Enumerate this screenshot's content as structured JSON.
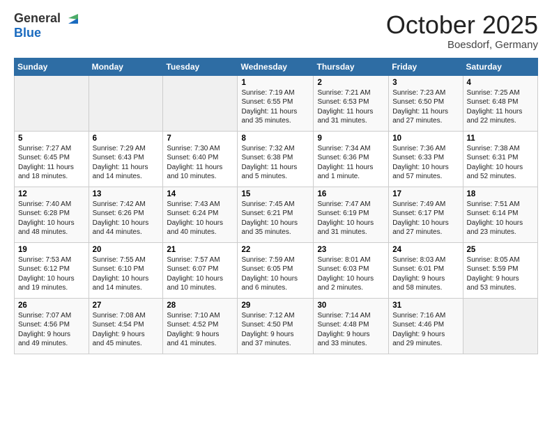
{
  "header": {
    "logo_line1": "General",
    "logo_line2": "Blue",
    "title": "October 2025",
    "location": "Boesdorf, Germany"
  },
  "days_of_week": [
    "Sunday",
    "Monday",
    "Tuesday",
    "Wednesday",
    "Thursday",
    "Friday",
    "Saturday"
  ],
  "weeks": [
    [
      {
        "day": "",
        "info": ""
      },
      {
        "day": "",
        "info": ""
      },
      {
        "day": "",
        "info": ""
      },
      {
        "day": "1",
        "info": "Sunrise: 7:19 AM\nSunset: 6:55 PM\nDaylight: 11 hours\nand 35 minutes."
      },
      {
        "day": "2",
        "info": "Sunrise: 7:21 AM\nSunset: 6:53 PM\nDaylight: 11 hours\nand 31 minutes."
      },
      {
        "day": "3",
        "info": "Sunrise: 7:23 AM\nSunset: 6:50 PM\nDaylight: 11 hours\nand 27 minutes."
      },
      {
        "day": "4",
        "info": "Sunrise: 7:25 AM\nSunset: 6:48 PM\nDaylight: 11 hours\nand 22 minutes."
      }
    ],
    [
      {
        "day": "5",
        "info": "Sunrise: 7:27 AM\nSunset: 6:45 PM\nDaylight: 11 hours\nand 18 minutes."
      },
      {
        "day": "6",
        "info": "Sunrise: 7:29 AM\nSunset: 6:43 PM\nDaylight: 11 hours\nand 14 minutes."
      },
      {
        "day": "7",
        "info": "Sunrise: 7:30 AM\nSunset: 6:40 PM\nDaylight: 11 hours\nand 10 minutes."
      },
      {
        "day": "8",
        "info": "Sunrise: 7:32 AM\nSunset: 6:38 PM\nDaylight: 11 hours\nand 5 minutes."
      },
      {
        "day": "9",
        "info": "Sunrise: 7:34 AM\nSunset: 6:36 PM\nDaylight: 11 hours\nand 1 minute."
      },
      {
        "day": "10",
        "info": "Sunrise: 7:36 AM\nSunset: 6:33 PM\nDaylight: 10 hours\nand 57 minutes."
      },
      {
        "day": "11",
        "info": "Sunrise: 7:38 AM\nSunset: 6:31 PM\nDaylight: 10 hours\nand 52 minutes."
      }
    ],
    [
      {
        "day": "12",
        "info": "Sunrise: 7:40 AM\nSunset: 6:28 PM\nDaylight: 10 hours\nand 48 minutes."
      },
      {
        "day": "13",
        "info": "Sunrise: 7:42 AM\nSunset: 6:26 PM\nDaylight: 10 hours\nand 44 minutes."
      },
      {
        "day": "14",
        "info": "Sunrise: 7:43 AM\nSunset: 6:24 PM\nDaylight: 10 hours\nand 40 minutes."
      },
      {
        "day": "15",
        "info": "Sunrise: 7:45 AM\nSunset: 6:21 PM\nDaylight: 10 hours\nand 35 minutes."
      },
      {
        "day": "16",
        "info": "Sunrise: 7:47 AM\nSunset: 6:19 PM\nDaylight: 10 hours\nand 31 minutes."
      },
      {
        "day": "17",
        "info": "Sunrise: 7:49 AM\nSunset: 6:17 PM\nDaylight: 10 hours\nand 27 minutes."
      },
      {
        "day": "18",
        "info": "Sunrise: 7:51 AM\nSunset: 6:14 PM\nDaylight: 10 hours\nand 23 minutes."
      }
    ],
    [
      {
        "day": "19",
        "info": "Sunrise: 7:53 AM\nSunset: 6:12 PM\nDaylight: 10 hours\nand 19 minutes."
      },
      {
        "day": "20",
        "info": "Sunrise: 7:55 AM\nSunset: 6:10 PM\nDaylight: 10 hours\nand 14 minutes."
      },
      {
        "day": "21",
        "info": "Sunrise: 7:57 AM\nSunset: 6:07 PM\nDaylight: 10 hours\nand 10 minutes."
      },
      {
        "day": "22",
        "info": "Sunrise: 7:59 AM\nSunset: 6:05 PM\nDaylight: 10 hours\nand 6 minutes."
      },
      {
        "day": "23",
        "info": "Sunrise: 8:01 AM\nSunset: 6:03 PM\nDaylight: 10 hours\nand 2 minutes."
      },
      {
        "day": "24",
        "info": "Sunrise: 8:03 AM\nSunset: 6:01 PM\nDaylight: 9 hours\nand 58 minutes."
      },
      {
        "day": "25",
        "info": "Sunrise: 8:05 AM\nSunset: 5:59 PM\nDaylight: 9 hours\nand 53 minutes."
      }
    ],
    [
      {
        "day": "26",
        "info": "Sunrise: 7:07 AM\nSunset: 4:56 PM\nDaylight: 9 hours\nand 49 minutes."
      },
      {
        "day": "27",
        "info": "Sunrise: 7:08 AM\nSunset: 4:54 PM\nDaylight: 9 hours\nand 45 minutes."
      },
      {
        "day": "28",
        "info": "Sunrise: 7:10 AM\nSunset: 4:52 PM\nDaylight: 9 hours\nand 41 minutes."
      },
      {
        "day": "29",
        "info": "Sunrise: 7:12 AM\nSunset: 4:50 PM\nDaylight: 9 hours\nand 37 minutes."
      },
      {
        "day": "30",
        "info": "Sunrise: 7:14 AM\nSunset: 4:48 PM\nDaylight: 9 hours\nand 33 minutes."
      },
      {
        "day": "31",
        "info": "Sunrise: 7:16 AM\nSunset: 4:46 PM\nDaylight: 9 hours\nand 29 minutes."
      },
      {
        "day": "",
        "info": ""
      }
    ]
  ]
}
